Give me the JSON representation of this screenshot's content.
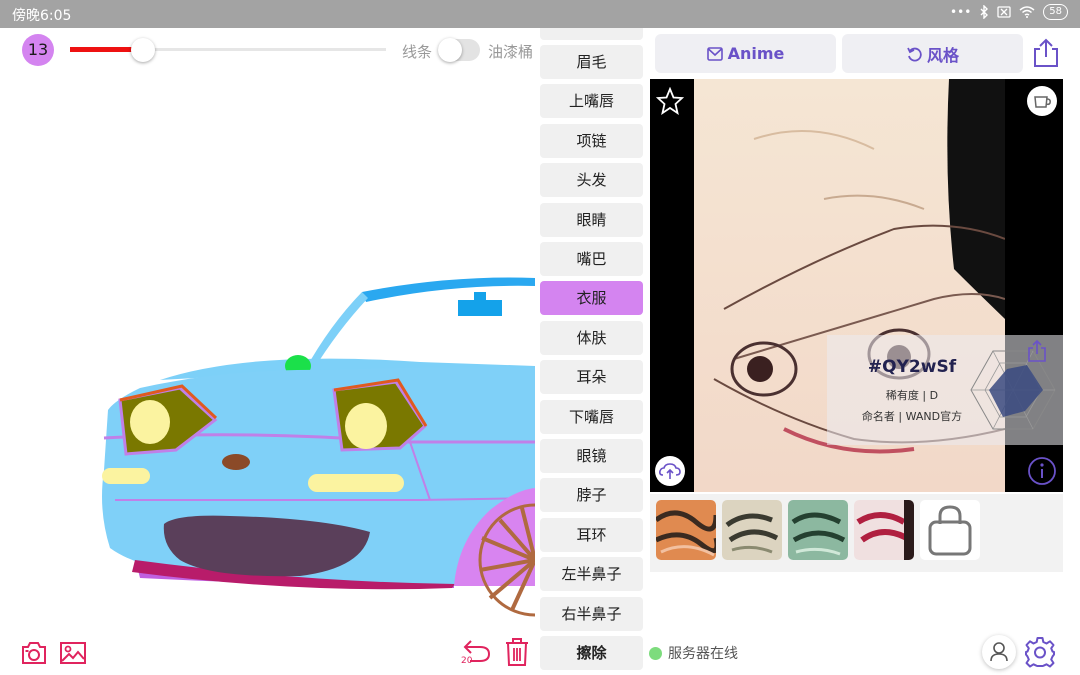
{
  "status_bar": {
    "time": "傍晚6:05",
    "battery": "58"
  },
  "toolbar": {
    "brush_size": "13",
    "brush_slider_fraction": 0.23,
    "lines_label": "线条",
    "bucket_label": "油漆桶",
    "fill_toggle_on": false
  },
  "categories": {
    "items": [
      "眉毛",
      "上嘴唇",
      "项链",
      "头发",
      "眼睛",
      "嘴巴",
      "衣服",
      "体肤",
      "耳朵",
      "下嘴唇",
      "眼镜",
      "脖子",
      "耳环",
      "左半鼻子",
      "右半鼻子",
      "擦除"
    ],
    "active": "衣服"
  },
  "right_panel": {
    "anime_label": "Anime",
    "style_label": "风格",
    "result_card": {
      "code": "#QY2wSf",
      "rarity": "稀有度 | D",
      "namer": "命名者 | WAND官方"
    }
  },
  "bottom": {
    "undo_count": "20",
    "server_status": "服务器在线"
  },
  "colors": {
    "accent": "#d484f0",
    "brand": "#6a52c8",
    "danger": "#e0245e",
    "online": "#7ddc7d"
  }
}
